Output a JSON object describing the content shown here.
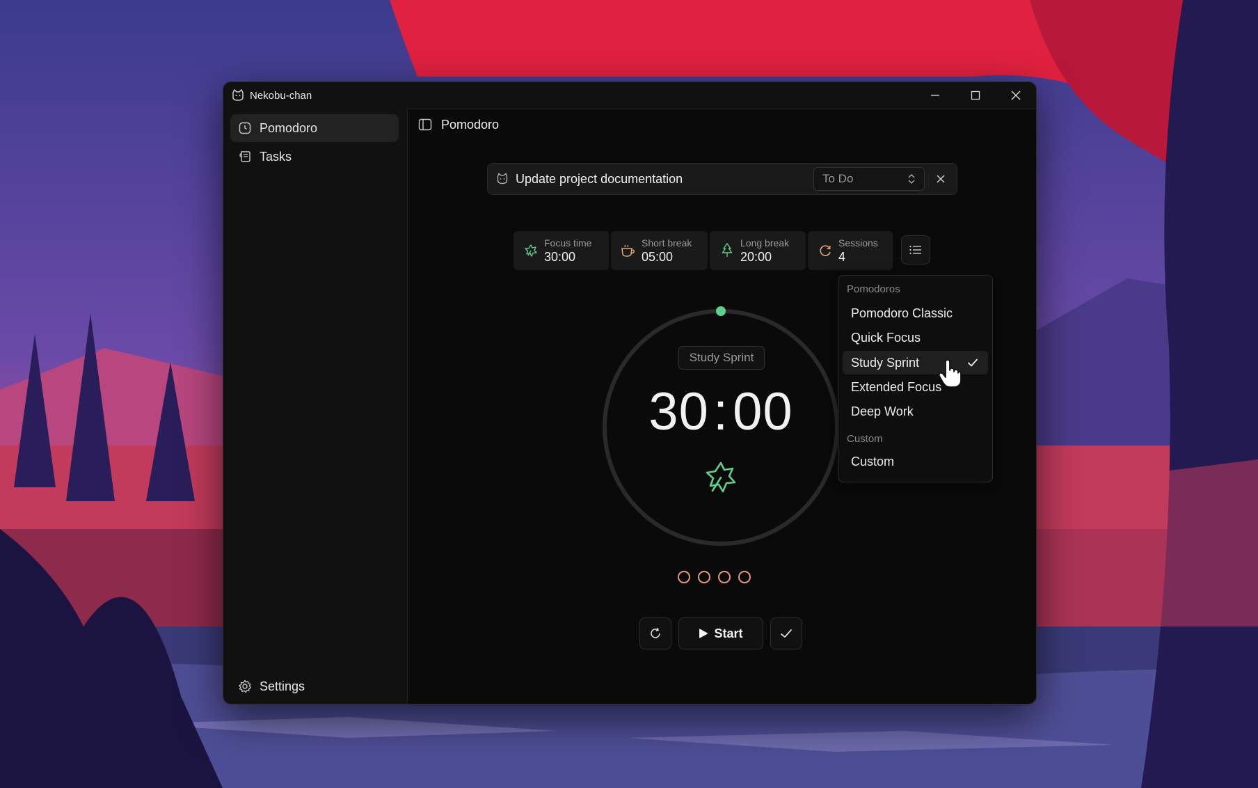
{
  "window": {
    "title": "Nekobu-chan",
    "controls": [
      "minimize-icon",
      "maximize-icon",
      "close-icon"
    ]
  },
  "sidebar": {
    "items": [
      {
        "label": "Pomodoro",
        "icon": "clock-icon",
        "active": true
      },
      {
        "label": "Tasks",
        "icon": "scroll-icon",
        "active": false
      }
    ],
    "settings_label": "Settings"
  },
  "main": {
    "header_title": "Pomodoro",
    "task": {
      "title": "Update project documentation",
      "status": "To Do"
    },
    "stats": [
      {
        "label": "Focus time",
        "value": "30:00",
        "icon": "leaf-icon"
      },
      {
        "label": "Short break",
        "value": "05:00",
        "icon": "coffee-icon"
      },
      {
        "label": "Long break",
        "value": "20:00",
        "icon": "tree-icon"
      },
      {
        "label": "Sessions",
        "value": "4",
        "icon": "loop-icon"
      }
    ],
    "timer": {
      "mode": "Study Sprint",
      "minutes": "30",
      "seconds": "00"
    },
    "session_count": 4,
    "start_label": "Start"
  },
  "presets_menu": {
    "groups": [
      {
        "label": "Pomodoros",
        "items": [
          "Pomodoro Classic",
          "Quick Focus",
          "Study Sprint",
          "Extended Focus",
          "Deep Work"
        ]
      },
      {
        "label": "Custom",
        "items": [
          "Custom"
        ]
      }
    ],
    "selected": "Study Sprint"
  },
  "colors": {
    "accent_green": "#5fcf8a",
    "session_dot": "#e89a7f",
    "coffee": "#e8a66b"
  }
}
